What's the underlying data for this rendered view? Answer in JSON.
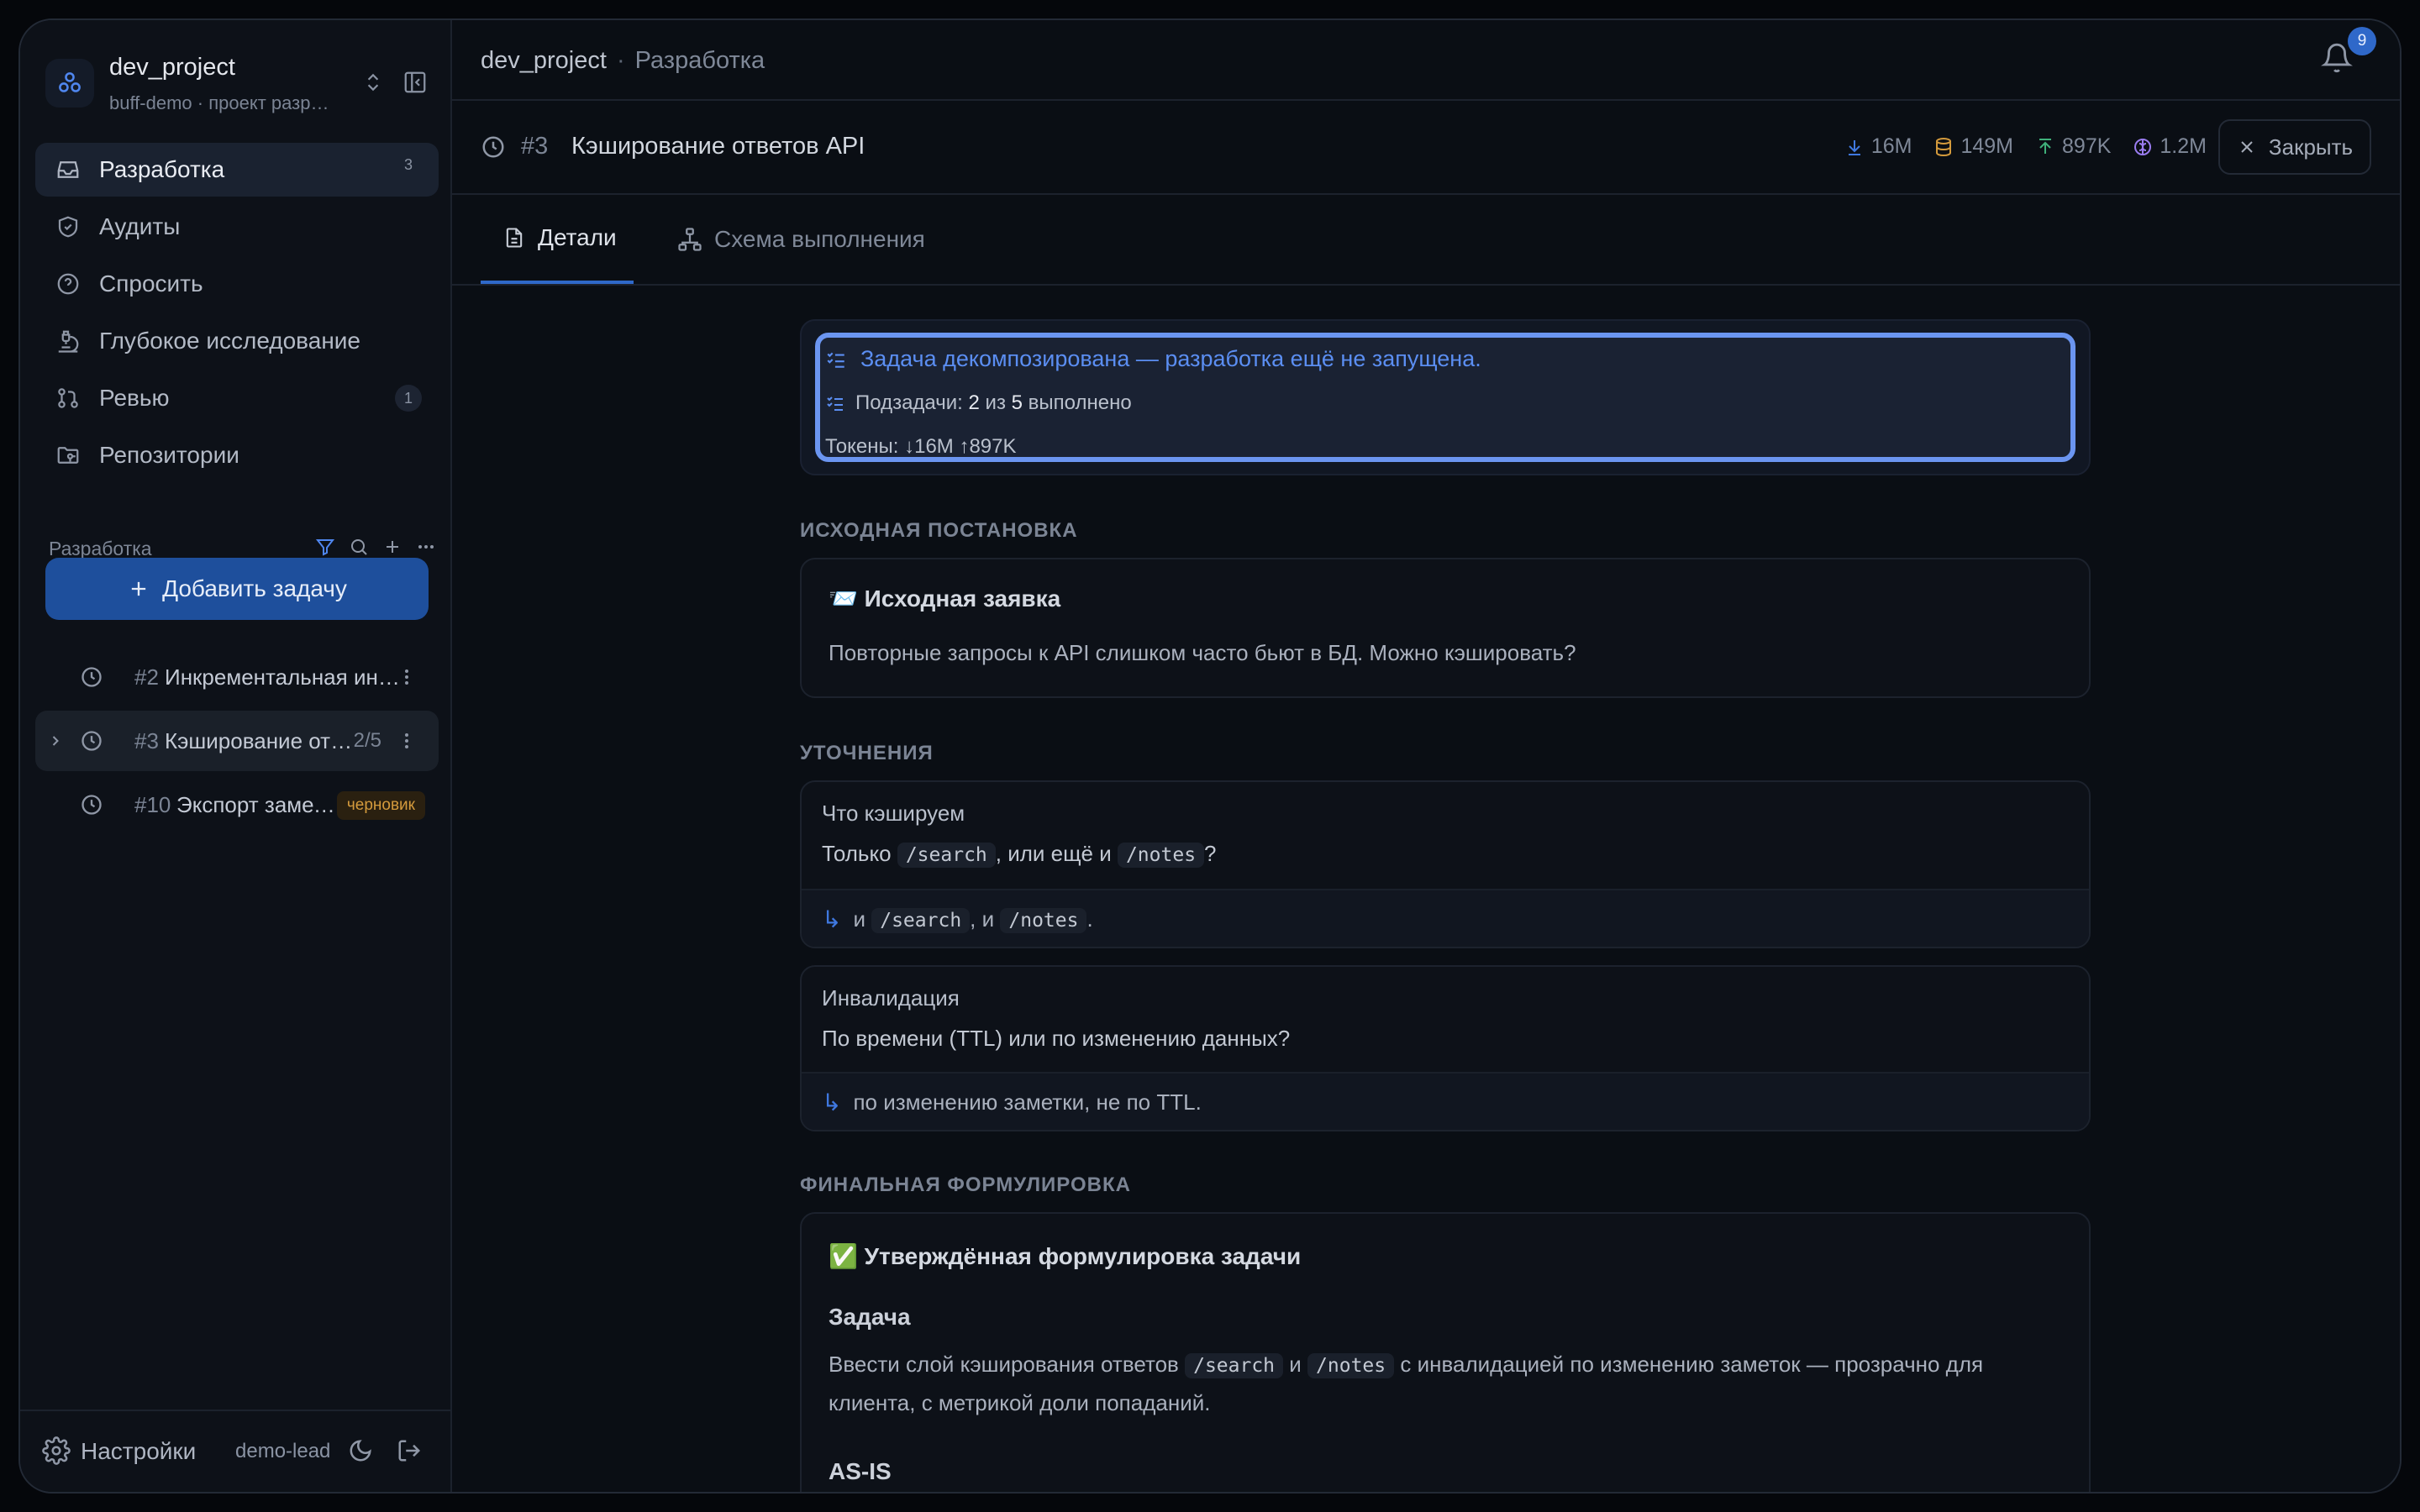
{
  "project": {
    "name": "dev_project",
    "subtitle": "buff-demo · проект разработки"
  },
  "nav": [
    {
      "label": "Разработка",
      "badge": "3",
      "icon": "inbox-icon",
      "active": true
    },
    {
      "label": "Аудиты",
      "badge": "",
      "icon": "shield-icon"
    },
    {
      "label": "Спросить",
      "badge": "",
      "icon": "help-circle-icon"
    },
    {
      "label": "Глубокое исследование",
      "badge": "",
      "icon": "microscope-icon"
    },
    {
      "label": "Ревью",
      "badge": "1",
      "icon": "git-pull-request-icon"
    },
    {
      "label": "Репозитории",
      "badge": "",
      "icon": "folder-git-icon"
    }
  ],
  "section": {
    "title": "Разработка",
    "add_task": "Добавить задачу"
  },
  "tasks": [
    {
      "num": "#2",
      "title": "Инкрементальная индексация",
      "progress": "",
      "draft": ""
    },
    {
      "num": "#3",
      "title": "Кэширование ответов API",
      "progress": "2/5",
      "draft": ""
    },
    {
      "num": "#10",
      "title": "Экспорт заметок",
      "progress": "",
      "draft": "черновик"
    }
  ],
  "footer": {
    "settings": "Настройки",
    "user": "demo-lead"
  },
  "breadcrumb": {
    "project": "dev_project",
    "sep": "·",
    "current": "Разработка"
  },
  "notifications": {
    "count": "9"
  },
  "task_header": {
    "num": "#3",
    "title": "Кэширование ответов API",
    "stats": {
      "download": "16M",
      "db": "149M",
      "upload": "897K",
      "brain": "1.2M"
    },
    "close_label": "Закрыть"
  },
  "tabs": {
    "details": "Детали",
    "schema": "Схема выполнения"
  },
  "status": {
    "headline": "Задача декомпозирована — разработка ещё не запущена.",
    "subtasks_label": "Подзадачи:",
    "subtasks_done": "2",
    "subtasks_of": "из",
    "subtasks_total": "5",
    "subtasks_suffix": "выполнено",
    "tokens": "Токены: ↓16M ↑897K"
  },
  "original": {
    "section_label": "ИСХОДНАЯ ПОСТАНОВКА",
    "title": "📨 Исходная заявка",
    "text": "Повторные запросы к API слишком часто бьют в БД. Можно кэшировать?"
  },
  "clarifications": {
    "section_label": "УТОЧНЕНИЯ",
    "items": [
      {
        "title": "Что кэшируем",
        "q_pre": "Только",
        "q_code1": "/search",
        "q_mid": ", или ещё и",
        "q_code2": "/notes",
        "q_post": "?",
        "a_pre": "и",
        "a_code1": "/search",
        "a_mid": ", и",
        "a_code2": "/notes",
        "a_post": "."
      },
      {
        "title": "Инвалидация",
        "q_text": "По времени (TTL) или по изменению данных?",
        "a_text": "по изменению заметки, не по TTL."
      }
    ]
  },
  "final": {
    "section_label": "ФИНАЛЬНАЯ ФОРМУЛИРОВКА",
    "title": "✅ Утверждённая формулировка задачи",
    "task_heading": "Задача",
    "task_pre": "Ввести слой кэширования ответов",
    "task_code1": "/search",
    "task_mid": "и",
    "task_code2": "/notes",
    "task_post": "с инвалидацией по изменению заметок — прозрачно для клиента, с метрикой доли попаданий.",
    "asis_heading": "AS-IS"
  }
}
